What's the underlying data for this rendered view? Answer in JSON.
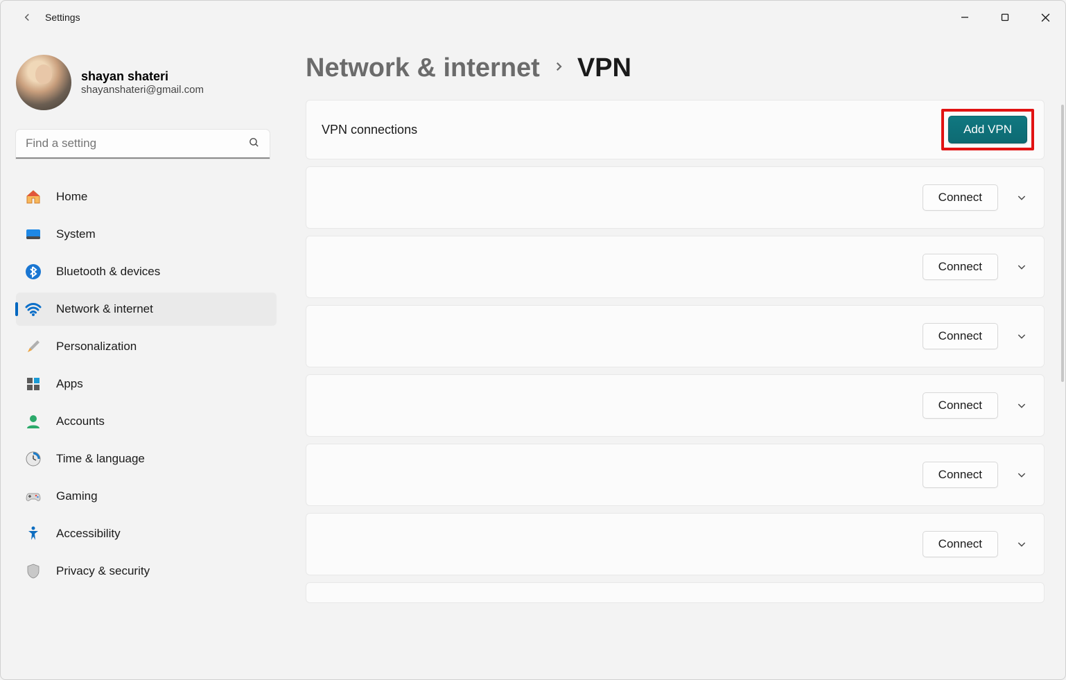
{
  "window": {
    "title": "Settings"
  },
  "profile": {
    "name": "shayan shateri",
    "email": "shayanshateri@gmail.com"
  },
  "search": {
    "placeholder": "Find a setting"
  },
  "sidebar": {
    "items": [
      {
        "label": "Home",
        "key": "home"
      },
      {
        "label": "System",
        "key": "system"
      },
      {
        "label": "Bluetooth & devices",
        "key": "bluetooth"
      },
      {
        "label": "Network & internet",
        "key": "network",
        "active": true
      },
      {
        "label": "Personalization",
        "key": "personalization"
      },
      {
        "label": "Apps",
        "key": "apps"
      },
      {
        "label": "Accounts",
        "key": "accounts"
      },
      {
        "label": "Time & language",
        "key": "time"
      },
      {
        "label": "Gaming",
        "key": "gaming"
      },
      {
        "label": "Accessibility",
        "key": "accessibility"
      },
      {
        "label": "Privacy & security",
        "key": "privacy"
      }
    ]
  },
  "breadcrumb": {
    "parent": "Network & internet",
    "current": "VPN"
  },
  "vpn_header": {
    "title": "VPN connections",
    "add_button": "Add VPN"
  },
  "vpn_rows": [
    {
      "connect_label": "Connect"
    },
    {
      "connect_label": "Connect"
    },
    {
      "connect_label": "Connect"
    },
    {
      "connect_label": "Connect"
    },
    {
      "connect_label": "Connect"
    },
    {
      "connect_label": "Connect"
    }
  ]
}
